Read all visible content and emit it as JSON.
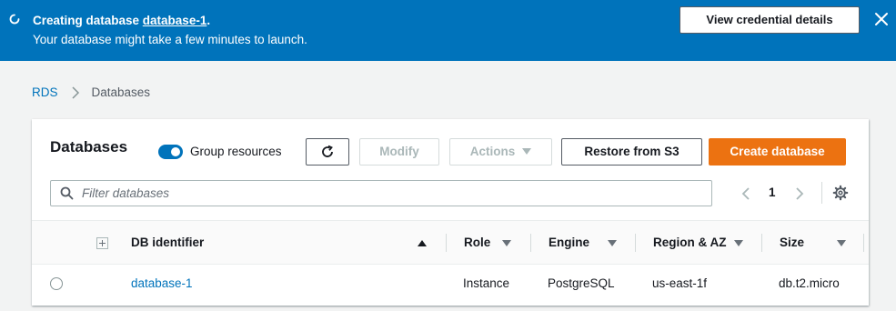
{
  "banner": {
    "prefix": "Creating database ",
    "db_name": "database-1",
    "suffix": ".",
    "subtitle": "Your database might take a few minutes to launch.",
    "button_label": "View credential details"
  },
  "breadcrumb": {
    "root": "RDS",
    "current": "Databases"
  },
  "panel": {
    "title": "Databases",
    "group_toggle_label": "Group resources",
    "group_toggle_on": true,
    "buttons": {
      "modify": "Modify",
      "actions": "Actions",
      "restore": "Restore from S3",
      "create": "Create database"
    },
    "filter_placeholder": "Filter databases",
    "page_number": "1"
  },
  "table": {
    "headers": {
      "identifier": "DB identifier",
      "role": "Role",
      "engine": "Engine",
      "region": "Region & AZ",
      "size": "Size"
    },
    "rows": [
      {
        "identifier": "database-1",
        "role": "Instance",
        "engine": "PostgreSQL",
        "region": "us-east-1f",
        "size": "db.t2.micro"
      }
    ]
  },
  "colors": {
    "banner": "#0073bb",
    "primary": "#ec7211",
    "link": "#0073bb"
  }
}
